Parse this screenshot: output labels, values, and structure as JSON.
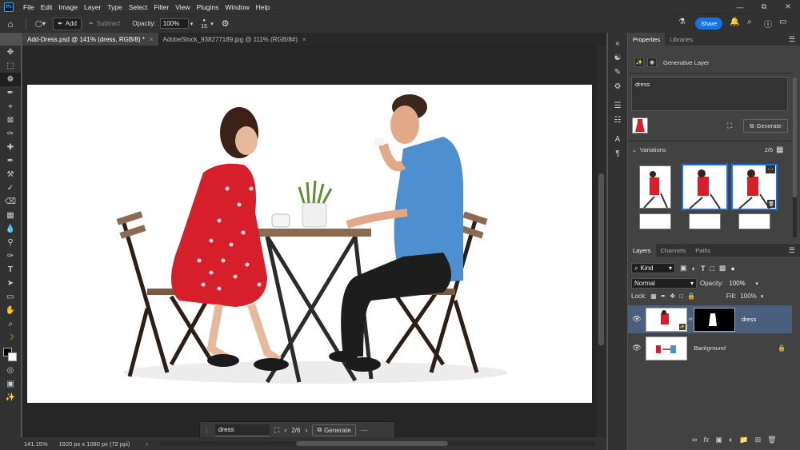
{
  "menubar": {
    "app_icon": "Ps",
    "items": [
      "File",
      "Edit",
      "Image",
      "Layer",
      "Type",
      "Select",
      "Filter",
      "View",
      "Plugins",
      "Window",
      "Help"
    ],
    "window_controls": [
      "minimize-icon",
      "restore-icon",
      "close-icon"
    ]
  },
  "options": {
    "add_label": "Add",
    "subtract_label": "Subtract",
    "opacity_label": "Opacity:",
    "opacity_value": "100%",
    "brush_size": "15",
    "share_label": "Share"
  },
  "tabs": [
    {
      "label": "Add-Dress.psd @ 141% (dress, RGB/8) *"
    },
    {
      "label": "AdobeStock_938277189.jpg @ 111% (RGB/8#)"
    }
  ],
  "status": {
    "zoom": "141.15%",
    "doc_info": "1920 px x 1080 px (72 ppi)"
  },
  "context_bar": {
    "prompt_value": "dress",
    "page": "2/6",
    "generate_label": "Generate"
  },
  "properties": {
    "tab_properties": "Properties",
    "tab_libraries": "Libraries",
    "layer_type": "Generative Layer",
    "prompt": "dress",
    "generate_label": "Generate",
    "variations_label": "Variations",
    "variations_count": "2/6"
  },
  "layers_panel": {
    "tabs": [
      "Layers",
      "Channels",
      "Paths"
    ],
    "filter_label": "Kind",
    "blend_mode": "Normal",
    "opacity_label": "Opacity:",
    "opacity_value": "100%",
    "lock_label": "Lock:",
    "fill_label": "Fill:",
    "fill_value": "100%",
    "layers": [
      {
        "name": "dress",
        "selected": true
      },
      {
        "name": "Background",
        "selected": false
      }
    ]
  },
  "colors": {
    "accent": "#1473e6",
    "dress_red": "#d71e2b",
    "shirt_blue": "#4e8fcf"
  }
}
